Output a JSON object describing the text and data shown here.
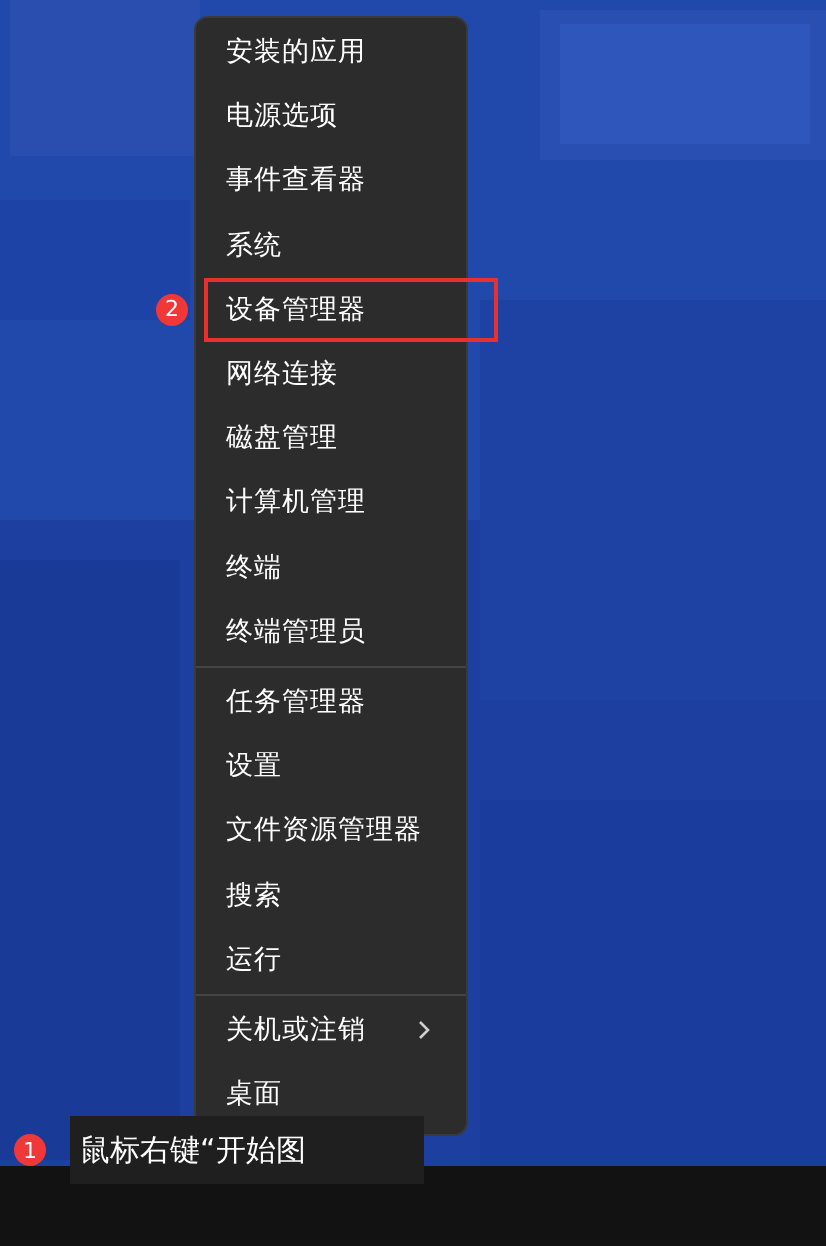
{
  "menu": {
    "groups": [
      {
        "items": [
          {
            "label": "安装的应用",
            "submenu": false,
            "annotated": false
          },
          {
            "label": "电源选项",
            "submenu": false,
            "annotated": false
          },
          {
            "label": "事件查看器",
            "submenu": false,
            "annotated": false
          },
          {
            "label": "系统",
            "submenu": false,
            "annotated": false
          },
          {
            "label": "设备管理器",
            "submenu": false,
            "annotated": true,
            "badge": "2"
          },
          {
            "label": "网络连接",
            "submenu": false,
            "annotated": false
          },
          {
            "label": "磁盘管理",
            "submenu": false,
            "annotated": false
          },
          {
            "label": "计算机管理",
            "submenu": false,
            "annotated": false
          },
          {
            "label": "终端",
            "submenu": false,
            "annotated": false
          },
          {
            "label": "终端管理员",
            "submenu": false,
            "annotated": false
          }
        ]
      },
      {
        "items": [
          {
            "label": "任务管理器",
            "submenu": false,
            "annotated": false
          },
          {
            "label": "设置",
            "submenu": false,
            "annotated": false
          },
          {
            "label": "文件资源管理器",
            "submenu": false,
            "annotated": false
          },
          {
            "label": "搜索",
            "submenu": false,
            "annotated": false
          },
          {
            "label": "运行",
            "submenu": false,
            "annotated": false
          }
        ]
      },
      {
        "items": [
          {
            "label": "关机或注销",
            "submenu": true,
            "annotated": false
          },
          {
            "label": "桌面",
            "submenu": false,
            "annotated": false
          }
        ]
      }
    ]
  },
  "tooltip": {
    "badge": "1",
    "text": "鼠标右键“开始图"
  }
}
